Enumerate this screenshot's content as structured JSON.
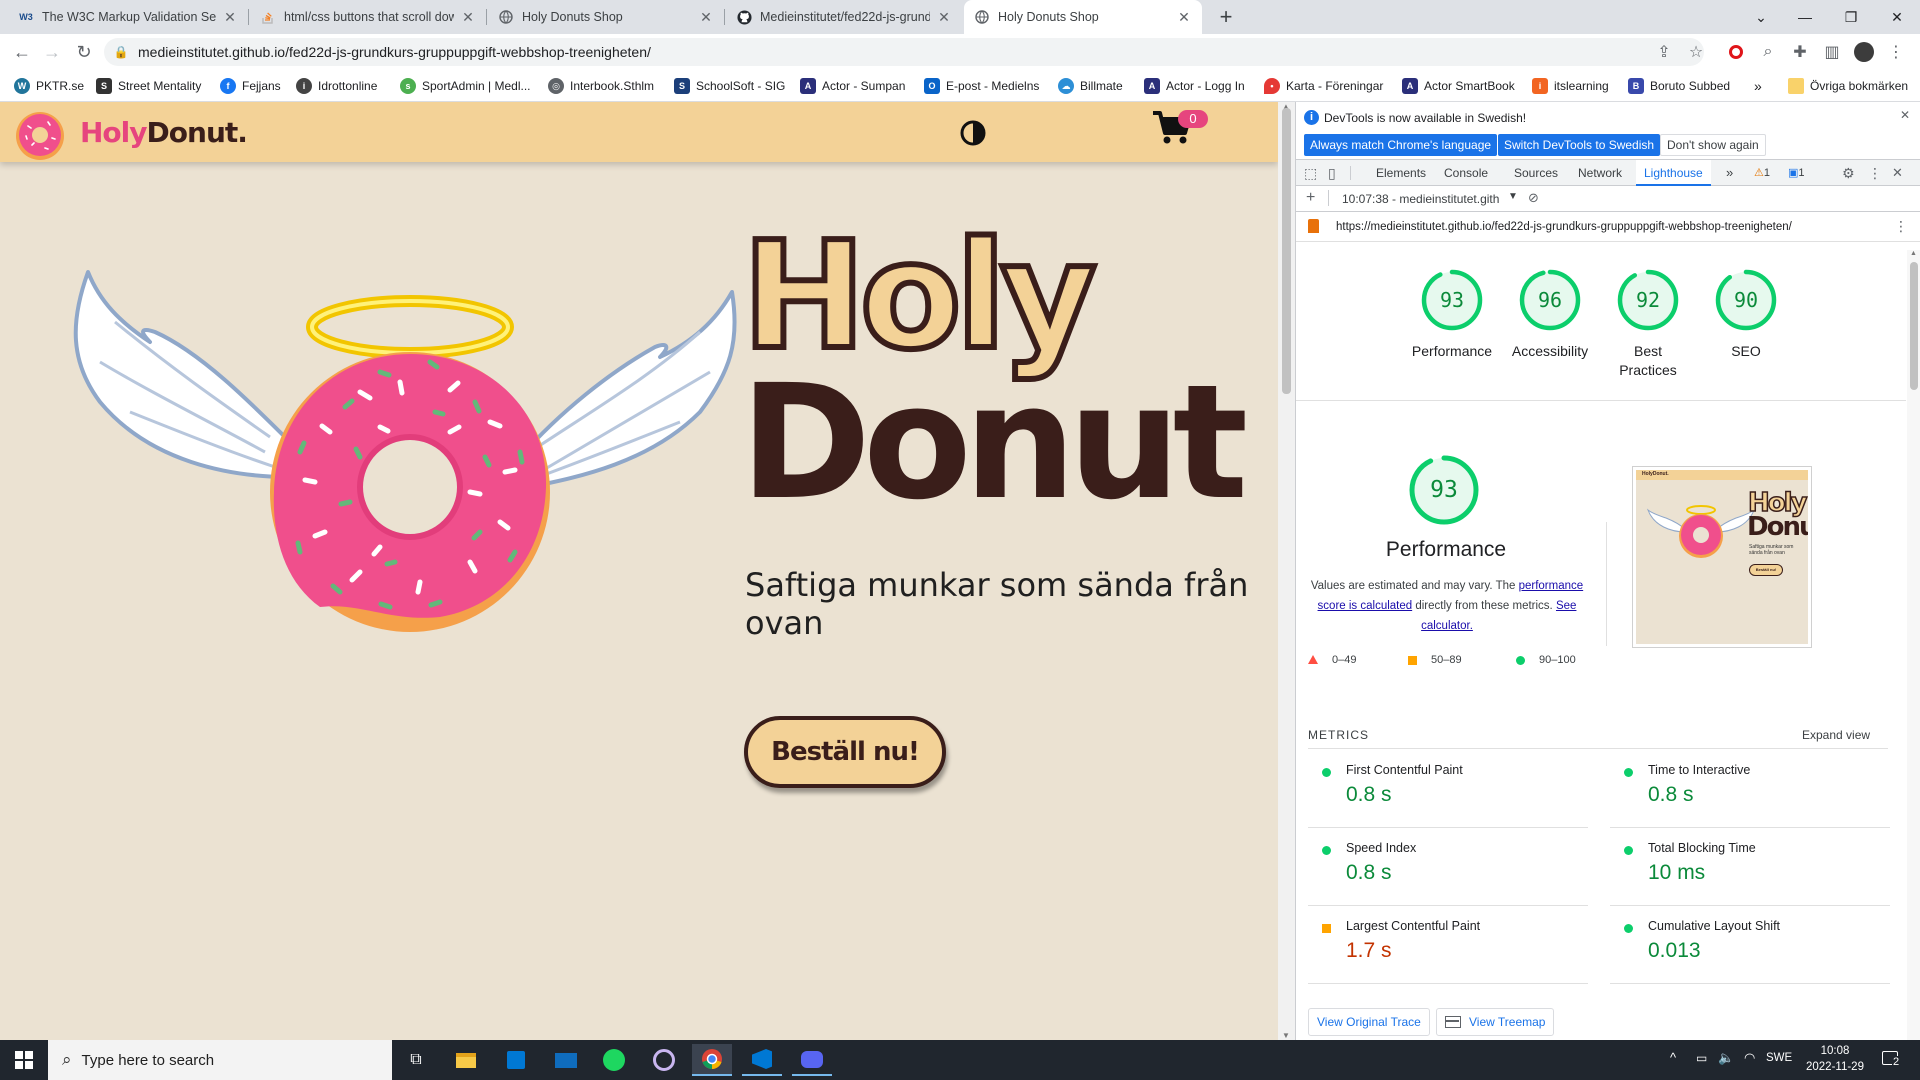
{
  "browser": {
    "tabs": [
      {
        "title": "The W3C Markup Validation Serv",
        "favicon": "w3c-icon"
      },
      {
        "title": "html/css buttons that scroll dow",
        "favicon": "stackoverflow-icon"
      },
      {
        "title": "Holy Donuts Shop",
        "favicon": "globe-icon"
      },
      {
        "title": "Medieinstitutet/fed22d-js-grundk",
        "favicon": "github-icon"
      },
      {
        "title": "Holy Donuts Shop",
        "favicon": "globe-icon",
        "active": true
      }
    ],
    "new_tab_label": "+",
    "url": "medieinstitutet.github.io/fed22d-js-grundkurs-gruppuppgift-webbshop-treenigheten/",
    "bookmarks": [
      "PKTR.se",
      "Street Mentality",
      "Fejjans",
      "Idrottonline",
      "SportAdmin | Medl...",
      "Interbook.Sthlm",
      "SchoolSoft - SIG",
      "Actor - Sumpan",
      "E-post - Medielns",
      "Billmate",
      "Actor - Logg In",
      "Karta - Föreningar",
      "Actor SmartBook",
      "itslearning",
      "Boruto Subbed"
    ],
    "bookmarks_more": "»",
    "other_bookmarks": "Övriga bokmärken"
  },
  "site": {
    "brand_holy": "Holy",
    "brand_donut": "Donut.",
    "cart_count": "0",
    "hero_line1": "Holy",
    "hero_line2": "Donut",
    "subtitle": "Saftiga munkar som sända från ovan",
    "order_button": "Beställ nu!"
  },
  "devtools": {
    "info_text": "DevTools is now available in Swedish!",
    "btn_match": "Always match Chrome's language",
    "btn_switch": "Switch DevTools to Swedish",
    "btn_dismiss": "Don't show again",
    "tabs": [
      "Elements",
      "Console",
      "Sources",
      "Network",
      "Lighthouse"
    ],
    "active_tab": "Lighthouse",
    "more_tabs": "»",
    "warnings": "1",
    "messages": "1",
    "report_select": "10:07:38 - medieinstitutet.gith",
    "report_url": "https://medieinstitutet.github.io/fed22d-js-grundkurs-gruppuppgift-webbshop-treenigheten/",
    "scores": [
      {
        "value": 93,
        "label": "Performance"
      },
      {
        "value": 96,
        "label": "Accessibility"
      },
      {
        "value": 92,
        "label": "Best Practices"
      },
      {
        "value": 90,
        "label": "SEO"
      }
    ],
    "perf_score": 93,
    "perf_title": "Performance",
    "perf_desc_1": "Values are estimated and may vary. The",
    "perf_link_1": "performance score is calculated",
    "perf_desc_2": "directly from these metrics.",
    "perf_link_2": "See calculator.",
    "legend": [
      "0–49",
      "50–89",
      "90–100"
    ],
    "thumb_brand": "HolyDonut.",
    "thumb_holy": "Holy",
    "thumb_donut": "Donut",
    "thumb_sub": "Saftiga munkar som sända från ovan",
    "thumb_btn": "Beställ nu!",
    "metrics_title": "METRICS",
    "expand_view": "Expand view",
    "metrics": [
      {
        "name": "First Contentful Paint",
        "value": "0.8 s",
        "status": "pass"
      },
      {
        "name": "Time to Interactive",
        "value": "0.8 s",
        "status": "pass"
      },
      {
        "name": "Speed Index",
        "value": "0.8 s",
        "status": "pass"
      },
      {
        "name": "Total Blocking Time",
        "value": "10 ms",
        "status": "pass"
      },
      {
        "name": "Largest Contentful Paint",
        "value": "1.7 s",
        "status": "average"
      },
      {
        "name": "Cumulative Layout Shift",
        "value": "0.013",
        "status": "pass"
      }
    ],
    "view_trace": "View Original Trace",
    "view_treemap": "View Treemap"
  },
  "taskbar": {
    "search_placeholder": "Type here to search",
    "language": "SWE",
    "time": "10:08",
    "date": "2022-11-29",
    "notifications": "2"
  },
  "colors": {
    "pass": "#0cce6b",
    "average": "#ffa400",
    "fail": "#ff4e42",
    "pass_text": "#0b8a3a",
    "average_text": "#c33300",
    "site_header": "#f3d297",
    "site_bg": "#ebe2d2",
    "brand_pink": "#e6457e",
    "brand_brown": "#3a1e1a"
  }
}
